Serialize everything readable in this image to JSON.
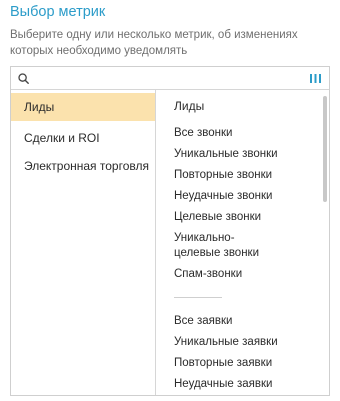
{
  "header": {
    "title": "Выбор метрик",
    "description": "Выберите одну или несколько метрик, об изменениях которых необходимо уведомлять"
  },
  "search": {
    "value": "",
    "placeholder": "",
    "icon": "search-icon",
    "columns_icon": "columns-icon",
    "accent_color": "#2c9cc9"
  },
  "categories": {
    "active_color": "#fbe2ad",
    "items": [
      {
        "label": "Лиды",
        "active": true
      },
      {
        "label": "Сделки и ROI",
        "active": false
      },
      {
        "label": "Электронная торговля",
        "active": false
      }
    ]
  },
  "metrics": {
    "group_title": "Лиды",
    "calls": [
      "Все звонки",
      "Уникальные звонки",
      "Повторные звонки",
      "Неудачные звонки",
      "Целевые звонки",
      "Уникально-целевые звонки",
      "Спам-звонки"
    ],
    "requests": [
      "Все заявки",
      "Уникальные заявки",
      "Повторные заявки",
      "Неудачные заявки"
    ]
  }
}
